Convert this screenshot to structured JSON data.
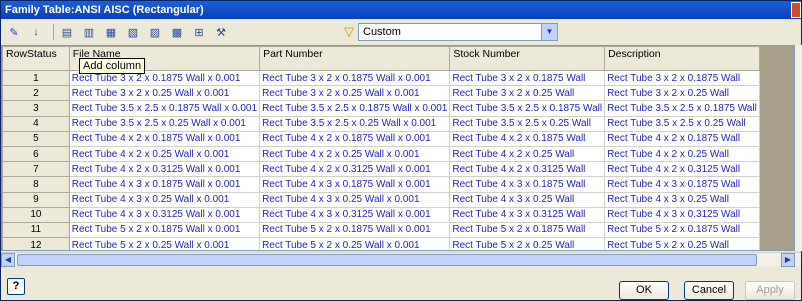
{
  "window": {
    "title": "Family Table:ANSI AISC (Rectangular)"
  },
  "toolbar": {
    "filter_value": "Custom",
    "tooltip": "Add column"
  },
  "columns": [
    "RowStatus",
    "File Name",
    "Part Number",
    "Stock Number",
    "Description"
  ],
  "rows": [
    [
      "1",
      "Rect Tube 3 x 2 x 0.1875 Wall x 0.001",
      "Rect Tube 3 x 2 x 0.1875 Wall x 0.001",
      "Rect Tube 3 x 2 x 0.1875 Wall",
      "Rect Tube 3 x 2 x 0.1875 Wall"
    ],
    [
      "2",
      "Rect Tube 3 x 2 x 0.25 Wall x 0.001",
      "Rect Tube 3 x 2 x 0.25 Wall x 0.001",
      "Rect Tube 3 x 2 x 0.25 Wall",
      "Rect Tube 3 x 2 x 0.25 Wall"
    ],
    [
      "3",
      "Rect Tube 3.5 x 2.5 x 0.1875 Wall x 0.001",
      "Rect Tube 3.5 x 2.5 x 0.1875 Wall x 0.001",
      "Rect Tube 3.5 x 2.5 x 0.1875 Wall",
      "Rect Tube 3.5 x 2.5 x 0.1875 Wall"
    ],
    [
      "4",
      "Rect Tube 3.5 x 2.5 x 0.25 Wall x 0.001",
      "Rect Tube 3.5 x 2.5 x 0.25 Wall x 0.001",
      "Rect Tube 3.5 x 2.5 x 0.25 Wall",
      "Rect Tube 3.5 x 2.5 x 0.25 Wall"
    ],
    [
      "5",
      "Rect Tube 4 x 2 x 0.1875 Wall x 0.001",
      "Rect Tube 4 x 2 x 0.1875 Wall x 0.001",
      "Rect Tube 4 x 2 x 0.1875 Wall",
      "Rect Tube 4 x 2 x 0.1875 Wall"
    ],
    [
      "6",
      "Rect Tube 4 x 2 x 0.25 Wall x 0.001",
      "Rect Tube 4 x 2 x 0.25 Wall x 0.001",
      "Rect Tube 4 x 2 x 0.25 Wall",
      "Rect Tube 4 x 2 x 0.25 Wall"
    ],
    [
      "7",
      "Rect Tube 4 x 2 x 0.3125 Wall x 0.001",
      "Rect Tube 4 x 2 x 0.3125 Wall x 0.001",
      "Rect Tube 4 x 2 x 0.3125 Wall",
      "Rect Tube 4 x 2 x 0.3125 Wall"
    ],
    [
      "8",
      "Rect Tube 4 x 3 x 0.1875 Wall x 0.001",
      "Rect Tube 4 x 3 x 0.1875 Wall x 0.001",
      "Rect Tube 4 x 3 x 0.1875 Wall",
      "Rect Tube 4 x 3 x 0.1875 Wall"
    ],
    [
      "9",
      "Rect Tube 4 x 3 x 0.25 Wall x 0.001",
      "Rect Tube 4 x 3 x 0.25 Wall x 0.001",
      "Rect Tube 4 x 3 x 0.25 Wall",
      "Rect Tube 4 x 3 x 0.25 Wall"
    ],
    [
      "10",
      "Rect Tube 4 x 3 x 0.3125 Wall x 0.001",
      "Rect Tube 4 x 3 x 0.3125 Wall x 0.001",
      "Rect Tube 4 x 3 x 0.3125 Wall",
      "Rect Tube 4 x 3 x 0.3125 Wall"
    ],
    [
      "11",
      "Rect Tube 5 x 2 x 0.1875 Wall x 0.001",
      "Rect Tube 5 x 2 x 0.1875 Wall x 0.001",
      "Rect Tube 5 x 2 x 0.1875 Wall",
      "Rect Tube 5 x 2 x 0.1875 Wall"
    ],
    [
      "12",
      "Rect Tube 5 x 2 x 0.25 Wall x 0.001",
      "Rect Tube 5 x 2 x 0.25 Wall x 0.001",
      "Rect Tube 5 x 2 x 0.25 Wall",
      "Rect Tube 5 x 2 x 0.25 Wall"
    ]
  ],
  "footer": {
    "help": "?",
    "ok": "OK",
    "cancel": "Cancel",
    "apply": "Apply"
  }
}
